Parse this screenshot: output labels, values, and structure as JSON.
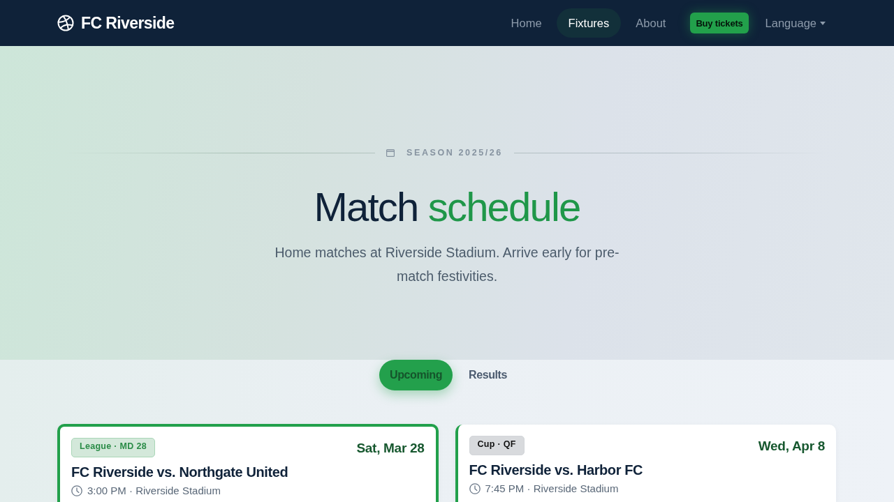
{
  "navbar": {
    "brand": "FC Riverside",
    "links": [
      {
        "label": "Home",
        "selected": false
      },
      {
        "label": "Fixtures",
        "selected": true
      },
      {
        "label": "About",
        "selected": false
      }
    ],
    "cta": "Buy tickets",
    "language": "Language"
  },
  "hero": {
    "eyebrow": "SEASON 2025/26",
    "title": "Match **schedule**",
    "subtitle": "Home matches at Riverside Stadium. Arrive early for pre-match festivities."
  },
  "tabs": [
    {
      "label": "Upcoming",
      "selected": true
    },
    {
      "label": "Results",
      "selected": false
    }
  ],
  "matches": [
    {
      "badge": "League · MD 28",
      "kind": "league",
      "date": "Sat, Mar 28",
      "title": "FC Riverside vs. Northgate United",
      "details": "3:00 PM · Riverside Stadium",
      "highlighted": true
    },
    {
      "badge": "Cup · QF",
      "kind": "cup",
      "date": "Wed, Apr 8",
      "title": "FC Riverside vs. Harbor FC",
      "details": "7:45 PM · Riverside Stadium",
      "highlighted": false
    }
  ]
}
